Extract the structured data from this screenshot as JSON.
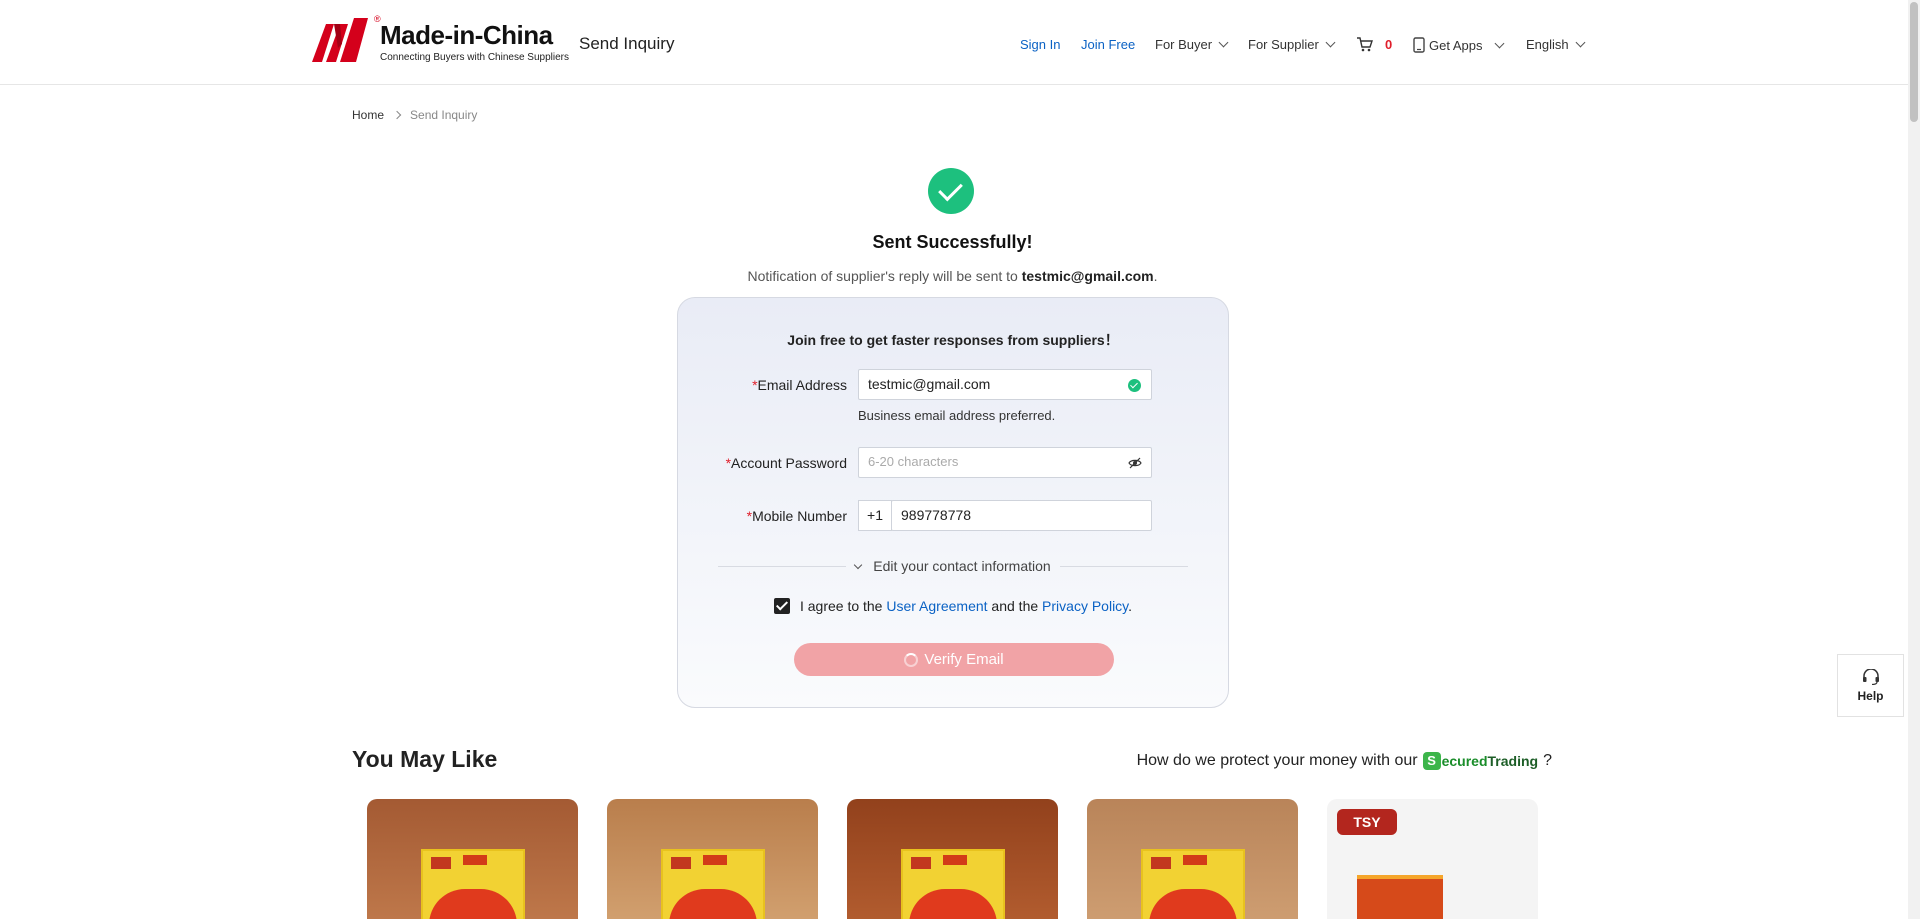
{
  "header": {
    "logo_text": "Made-in-China",
    "logo_tagline": "Connecting Buyers with Chinese Suppliers",
    "logo_reg": "®",
    "page_tag": "Send Inquiry",
    "nav": {
      "sign_in": "Sign In",
      "join_free": "Join Free",
      "for_buyer": "For Buyer",
      "for_supplier": "For Supplier",
      "cart_count": "0",
      "get_apps": "Get Apps",
      "language": "English"
    }
  },
  "breadcrumb": {
    "home": "Home",
    "current": "Send Inquiry"
  },
  "success": {
    "title": "Sent Successfully!",
    "notify_prefix": "Notification of supplier's reply will be sent to ",
    "notify_email": "testmic@gmail.com",
    "notify_suffix": "."
  },
  "form": {
    "title": "Join free to get faster responses from suppliers！",
    "required_mark": "*",
    "email_label": "Email Address",
    "email_value": "testmic@gmail.com",
    "email_hint": "Business email address preferred.",
    "password_label": "Account Password",
    "password_placeholder": "6-20 characters",
    "mobile_label": "Mobile Number",
    "mobile_prefix": "+1",
    "mobile_value": "989778778",
    "edit_contact": "Edit your contact information",
    "agree_prefix": "I agree to the ",
    "user_agreement": "User Agreement",
    "agree_middle": " and the ",
    "privacy_policy": "Privacy Policy",
    "agree_suffix": ".",
    "verify_button": "Verify Email"
  },
  "help": {
    "label": "Help"
  },
  "recommend": {
    "title": "You May Like",
    "protect_text": "How do we protect your money with our",
    "secured_s": "S",
    "secured_ecured": "ecured",
    "secured_trading": "Trading",
    "question": "?",
    "tsy_logo": "TSY"
  },
  "colors": {
    "brand_red": "#d4001b",
    "link_blue": "#0b62c4",
    "success_green": "#1dc07e",
    "button_disabled": "#f1a3a6"
  }
}
